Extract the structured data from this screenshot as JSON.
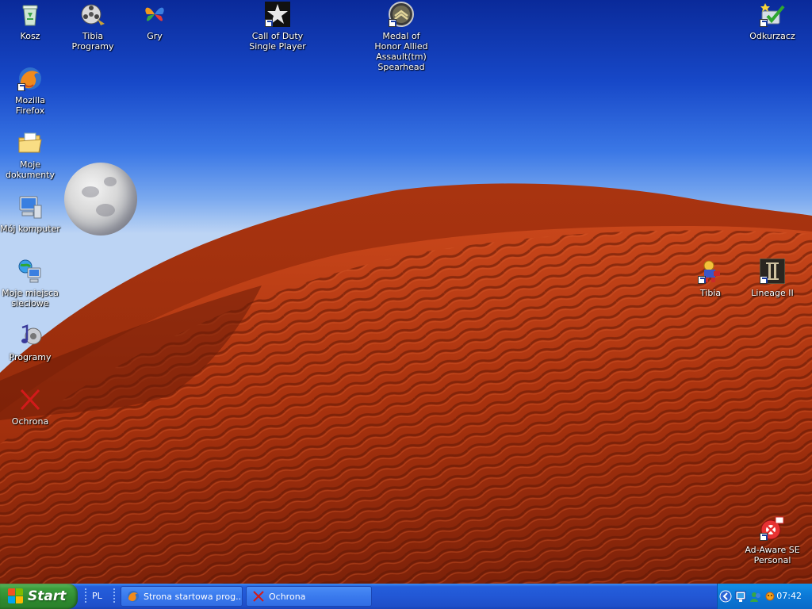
{
  "desktop": {
    "icons": [
      {
        "id": "kosz",
        "label": "Kosz",
        "icon": "recycle-bin-icon"
      },
      {
        "id": "tibia-programy",
        "label": "Tibia Programy",
        "icon": "film-reel-icon"
      },
      {
        "id": "gry",
        "label": "Gry",
        "icon": "msn-butterfly-icon"
      },
      {
        "id": "call-of-duty",
        "label": "Call of Duty Single Player",
        "icon": "star-badge-icon"
      },
      {
        "id": "medal-of-honor",
        "label": "Medal of Honor Allied Assault(tm) Spearhead",
        "icon": "medal-icon"
      },
      {
        "id": "odkurzacz",
        "label": "Odkurzacz",
        "icon": "checkmark-disk-icon"
      },
      {
        "id": "firefox",
        "label": "Mozilla Firefox",
        "icon": "firefox-icon"
      },
      {
        "id": "moje-dokumenty",
        "label": "Moje dokumenty",
        "icon": "documents-folder-icon"
      },
      {
        "id": "moj-komputer",
        "label": "Mój komputer",
        "icon": "computer-icon"
      },
      {
        "id": "moje-miejsca",
        "label": "Moje miejsca sieciowe",
        "icon": "network-places-icon"
      },
      {
        "id": "programy",
        "label": "Programy",
        "icon": "music-note-icon"
      },
      {
        "id": "ochrona",
        "label": "Ochrona",
        "icon": "red-x-icon"
      },
      {
        "id": "tibia",
        "label": "Tibia",
        "icon": "tibia-character-icon"
      },
      {
        "id": "lineage",
        "label": "Lineage II",
        "icon": "lineage-icon"
      },
      {
        "id": "ad-aware",
        "label": "Ad-Aware SE Personal",
        "icon": "ad-aware-icon"
      }
    ]
  },
  "taskbar": {
    "start_label": "Start",
    "language": "PL",
    "buttons": [
      {
        "label": "Strona startowa prog...",
        "icon": "firefox-icon"
      },
      {
        "label": "Ochrona",
        "icon": "red-x-icon"
      }
    ],
    "tray_icons": [
      "chevron-left-icon",
      "network-icon",
      "messenger-icon",
      "sun-icon"
    ],
    "clock": "07:42"
  },
  "colors": {
    "sky_top": "#0a2a9a",
    "dune": "#b8360f",
    "taskbar": "#245edb",
    "start_green": "#3c9e3c",
    "tray": "#0c78d6"
  }
}
